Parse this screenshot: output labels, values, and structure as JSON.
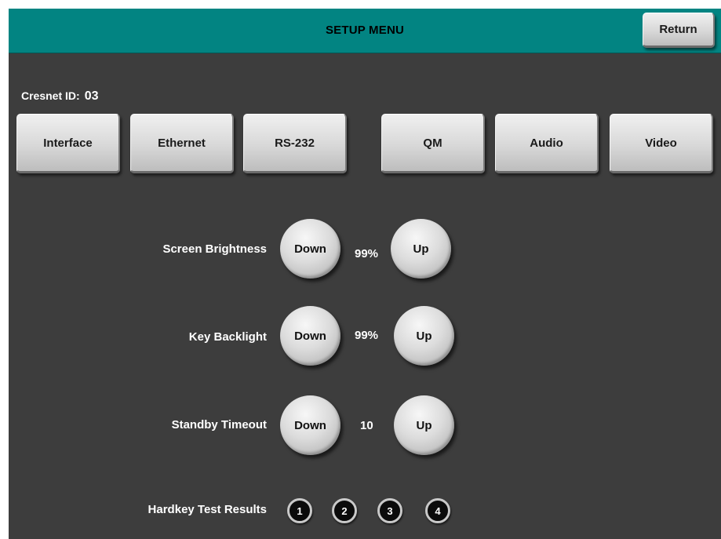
{
  "header": {
    "title": "SETUP MENU",
    "return_label": "Return"
  },
  "cresnet": {
    "label": "Cresnet ID:",
    "id": "03"
  },
  "tabs": [
    {
      "label": "Interface"
    },
    {
      "label": "Ethernet"
    },
    {
      "label": "RS-232"
    },
    {
      "label": "QM"
    },
    {
      "label": "Audio"
    },
    {
      "label": "Video"
    }
  ],
  "settings": [
    {
      "label": "Screen Brightness",
      "down_label": "Down",
      "value": "99%",
      "up_label": "Up"
    },
    {
      "label": "Key Backlight",
      "down_label": "Down",
      "value": "99%",
      "up_label": "Up"
    },
    {
      "label": "Standby Timeout",
      "down_label": "Down",
      "value": "10",
      "up_label": "Up"
    }
  ],
  "hardkey": {
    "label": "Hardkey Test Results",
    "keys": [
      "1",
      "2",
      "3",
      "4"
    ]
  },
  "colors": {
    "header": "#028482",
    "background": "#3d3d3d"
  }
}
